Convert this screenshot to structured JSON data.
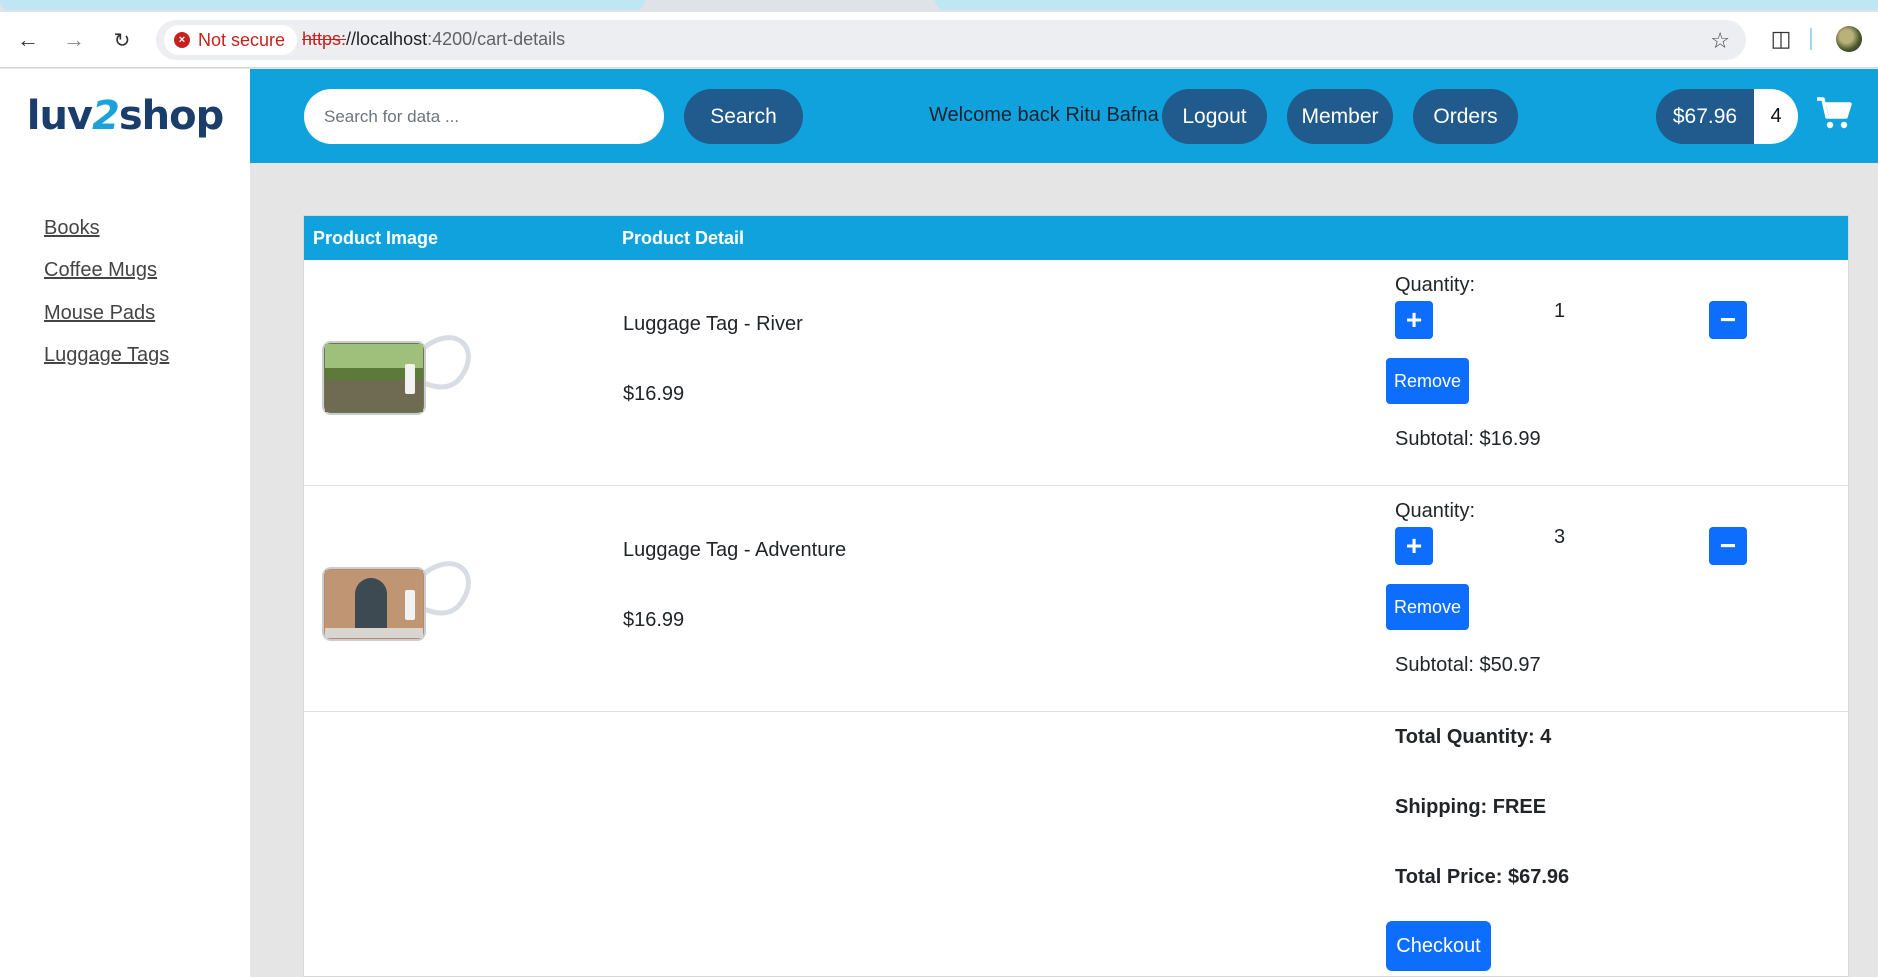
{
  "browser": {
    "security_label": "Not secure",
    "url_scheme": "https:",
    "url_host": "//localhost",
    "url_path": ":4200/cart-details"
  },
  "header": {
    "logo_part1": "luv",
    "logo_part2": "2",
    "logo_part3": "shop",
    "search_placeholder": "Search for data ...",
    "search_button": "Search",
    "welcome_text": "Welcome back Ritu Bafna",
    "logout_button": "Logout",
    "member_button": "Member",
    "orders_button": "Orders",
    "cart_total": "$67.96",
    "cart_count": "4"
  },
  "sidebar": {
    "items": [
      {
        "label": "Books"
      },
      {
        "label": "Coffee Mugs"
      },
      {
        "label": "Mouse Pads"
      },
      {
        "label": "Luggage Tags"
      }
    ]
  },
  "table": {
    "col_image": "Product Image",
    "col_detail": "Product Detail",
    "items": [
      {
        "name": "Luggage Tag - River",
        "price": "$16.99",
        "quantity_label": "Quantity:",
        "quantity": "1",
        "remove_label": "Remove",
        "subtotal": "Subtotal: $16.99"
      },
      {
        "name": "Luggage Tag - Adventure",
        "price": "$16.99",
        "quantity_label": "Quantity:",
        "quantity": "3",
        "remove_label": "Remove",
        "subtotal": "Subtotal: $50.97"
      }
    ]
  },
  "summary": {
    "total_quantity": "Total Quantity: 4",
    "shipping": "Shipping: FREE",
    "total_price": "Total Price: $67.96",
    "checkout_label": "Checkout"
  },
  "colors": {
    "header_bg": "#10a2dc",
    "pill_bg": "#215a8d",
    "primary_button": "#0d6efd"
  }
}
